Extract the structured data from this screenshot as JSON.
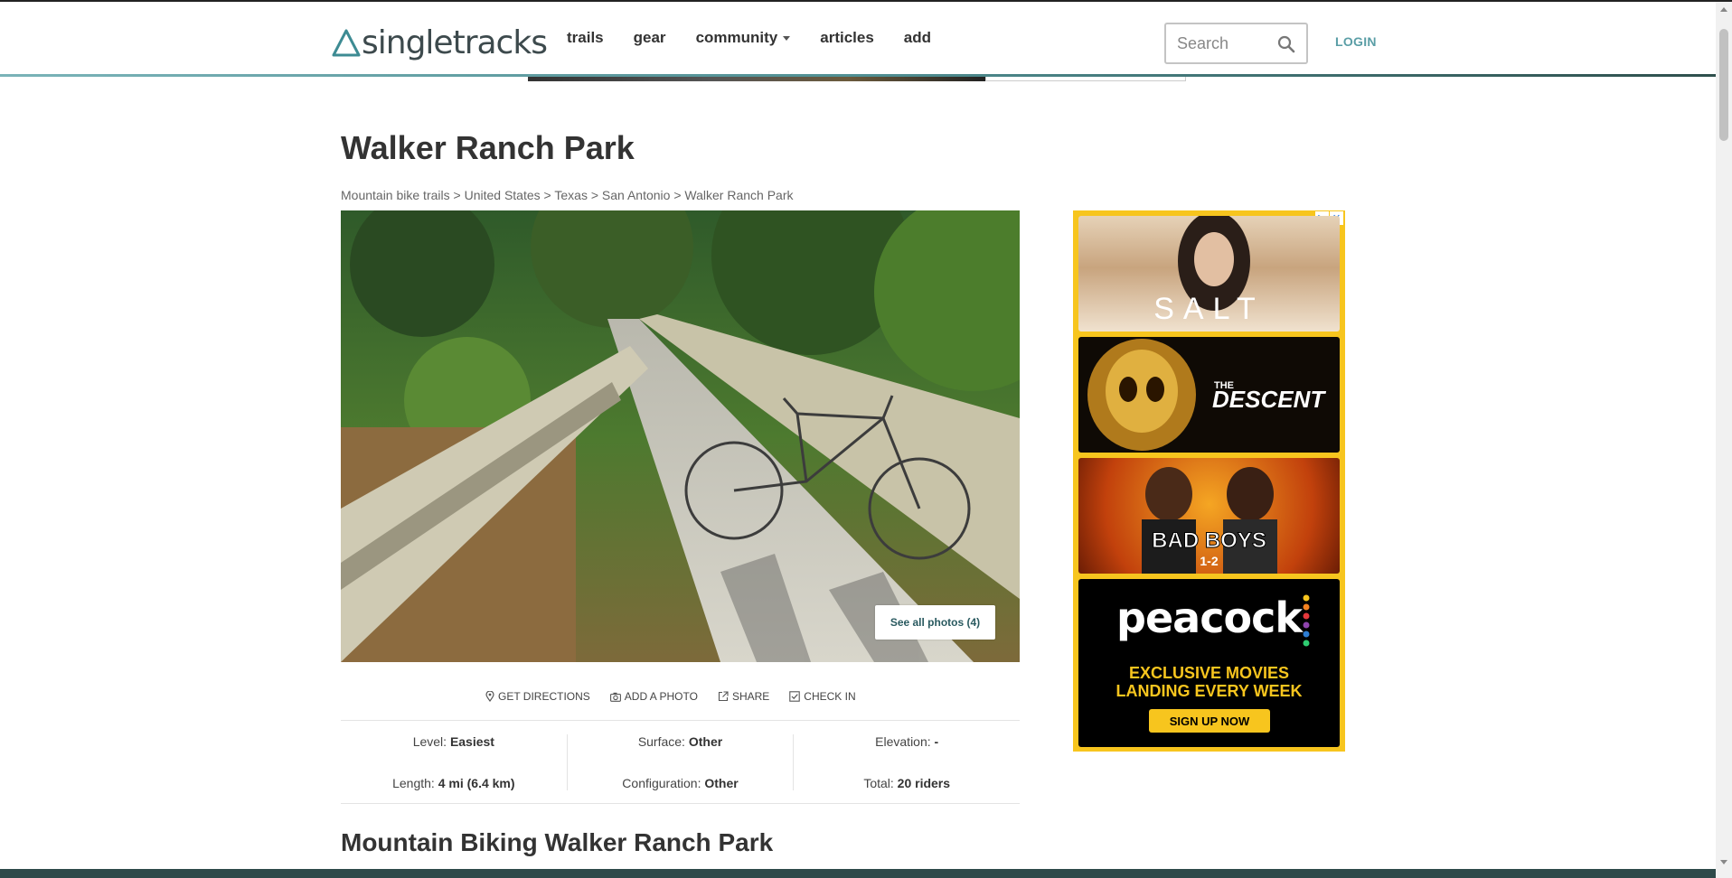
{
  "header": {
    "logo_text": "singletracks",
    "nav": [
      {
        "label": "trails"
      },
      {
        "label": "gear"
      },
      {
        "label": "community"
      },
      {
        "label": "articles"
      },
      {
        "label": "add"
      }
    ],
    "search_placeholder": "Search",
    "login_label": "LOGIN"
  },
  "page": {
    "title": "Walker Ranch Park",
    "breadcrumb": [
      "Mountain bike trails",
      "United States",
      "Texas",
      "San Antonio",
      "Walker Ranch Park"
    ],
    "breadcrumb_separator": ">",
    "see_all_photos": "See all photos (4)",
    "actions": [
      {
        "label": "GET DIRECTIONS",
        "icon": "map-pin-icon"
      },
      {
        "label": "ADD A PHOTO",
        "icon": "camera-icon"
      },
      {
        "label": "SHARE",
        "icon": "share-icon"
      },
      {
        "label": "CHECK IN",
        "icon": "checkbox-icon"
      }
    ],
    "stats": {
      "level_label": "Level:",
      "level_value": "Easiest",
      "length_label": "Length:",
      "length_value": "4 mi (6.4 km)",
      "surface_label": "Surface:",
      "surface_value": "Other",
      "configuration_label": "Configuration:",
      "configuration_value": "Other",
      "elevation_label": "Elevation:",
      "elevation_value": "-",
      "total_label": "Total:",
      "total_value": "20 riders"
    },
    "section_title": "Mountain Biking Walker Ranch Park"
  },
  "ad": {
    "tiles": [
      {
        "title": "SALT"
      },
      {
        "title_small": "THE",
        "title": "DESCENT"
      },
      {
        "title": "BAD BOYS",
        "subtitle": "1-2"
      },
      {
        "logo": "peacock",
        "line1": "EXCLUSIVE MOVIES",
        "line2": "LANDING EVERY WEEK",
        "cta": "SIGN UP NOW"
      }
    ],
    "badge_icons": [
      "ad-choices-icon",
      "close-icon"
    ]
  },
  "colors": {
    "accent": "#5a9ea6",
    "header_line": "#4f8f93",
    "ad_background": "#f7c51e",
    "text": "#333333"
  }
}
